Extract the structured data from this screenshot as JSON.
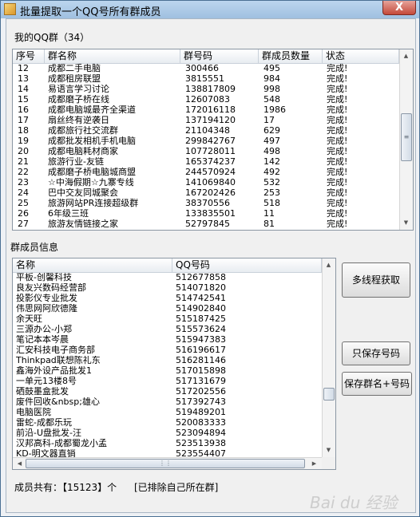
{
  "window": {
    "title": "批量提取一个QQ号所有群成员",
    "close_label": "X"
  },
  "groups": {
    "label": "我的QQ群（34）",
    "columns": [
      "序号",
      "群名称",
      "群号码",
      "群成员数量",
      "状态"
    ],
    "rows": [
      [
        "12",
        "成都二手电脑",
        "300466",
        "495",
        "完成!"
      ],
      [
        "13",
        "成都租房联盟",
        "3815551",
        "984",
        "完成!"
      ],
      [
        "14",
        "易语言学习讨论",
        "138817809",
        "998",
        "完成!"
      ],
      [
        "15",
        "成都磨子桥在线",
        "12607083",
        "548",
        "完成!"
      ],
      [
        "16",
        "成都电脑城最齐全渠道",
        "172016118",
        "1986",
        "完成!"
      ],
      [
        "17",
        "扇丝终有逆袭日",
        "137194120",
        "17",
        "完成!"
      ],
      [
        "18",
        "成都旅行社交流群",
        "21104348",
        "629",
        "完成!"
      ],
      [
        "19",
        "成都批发相机手机电脑",
        "299842767",
        "497",
        "完成!"
      ],
      [
        "20",
        "成都电脑耗材商家",
        "107728011",
        "498",
        "完成!"
      ],
      [
        "21",
        "旅游行业-友链",
        "165374237",
        "142",
        "完成!"
      ],
      [
        "22",
        "成都磨子桥电脑城商盟",
        "244570924",
        "492",
        "完成!"
      ],
      [
        "23",
        "☆中海假期☆九寨专线",
        "141069840",
        "532",
        "完成!"
      ],
      [
        "24",
        "巴中交友同城聚会",
        "167202426",
        "253",
        "完成!"
      ],
      [
        "25",
        "旅游网站PR连接超级群",
        "38370556",
        "518",
        "完成!"
      ],
      [
        "26",
        "6年级三班",
        "133835501",
        "11",
        "完成!"
      ],
      [
        "27",
        "旅游友情链接之家",
        "52797845",
        "81",
        "完成!"
      ]
    ]
  },
  "members": {
    "label": "群成员信息",
    "columns": [
      "名称",
      "QQ号码"
    ],
    "rows": [
      [
        "平板-创馨科技",
        "512677858"
      ],
      [
        "良友兴数码经营部",
        "514071820"
      ],
      [
        "投影仪专业批发",
        "514742541"
      ],
      [
        "伟思网阿欣德隆",
        "514902840"
      ],
      [
        "余天旺",
        "515187425"
      ],
      [
        "三源办公-小郑",
        "515573624"
      ],
      [
        "笔记本本岑晨",
        "515947383"
      ],
      [
        "汇安科技电子商务部",
        "516196617"
      ],
      [
        "Thinkpad联想陈礼东",
        "516281146"
      ],
      [
        "鑫海外设产品批发1",
        "517015898"
      ],
      [
        "一单元13楼8号",
        "517131679"
      ],
      [
        "硒鼓墨盒批发",
        "517202556"
      ],
      [
        "废件回收&nbsp;雄心",
        "517392743"
      ],
      [
        "电脑医院",
        "519489201"
      ],
      [
        "雷蛇-成都乐玩",
        "520083333"
      ],
      [
        "前沿-U盘批发-汪",
        "523094894"
      ],
      [
        "汉邦高科-成都蜀龙小孟",
        "523513938"
      ],
      [
        "KD-明文器直销",
        "523554407"
      ]
    ]
  },
  "buttons": {
    "multithread": "多线程获取",
    "save_numbers": "只保存号码",
    "save_group_numbers": "保存群名+号码"
  },
  "footer": {
    "total_text": "成员共有：【15123】个",
    "excluded_text": "[已排除自己所在群]"
  },
  "watermark": "Bai du 经验",
  "colors": {
    "title_bar": "#a9c8e6",
    "close_button": "#c4493a",
    "list_bg": "#ffffff",
    "client_bg": "#f0f0f0"
  }
}
